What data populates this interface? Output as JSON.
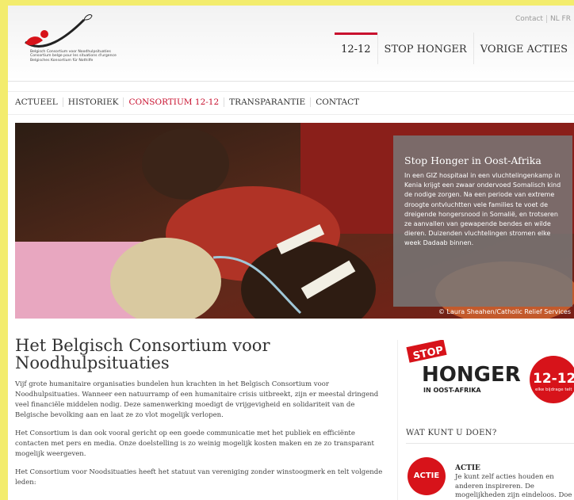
{
  "logo": {
    "lines": [
      "Belgisch Consortium voor Noodhulpsituaties",
      "Consortium belge pour les situations d'urgence",
      "Belgisches Konsortium für Nothilfe"
    ]
  },
  "utility": {
    "contact": "Contact",
    "languages": "NL FR"
  },
  "main_nav": [
    "12-12",
    "STOP HONGER",
    "VORIGE ACTIES"
  ],
  "sub_nav": [
    "ACTUEEL",
    "HISTORIEK",
    "CONSORTIUM 12-12",
    "TRANSPARANTIE",
    "CONTACT"
  ],
  "hero": {
    "title": "Stop Honger in Oost-Afrika",
    "text": "In een GIZ hospitaal in een vluchtelingenkamp in Kenia krijgt een zwaar ondervoed Somalisch kind de nodige zorgen. Na een periode van extreme droogte ontvluchtten vele families te voet de dreigende hongersnood in Somalië, en trotseren ze aanvallen van gewapende bendes en wilde dieren. Duizenden vluchtelingen stromen elke week Dadaab binnen.",
    "credit": "© Laura Sheahen/Catholic Relief Services"
  },
  "content": {
    "title": "Het Belgisch Consortium voor Noodhulpsituaties",
    "p1": "Vijf grote humanitaire organisaties bundelen hun krachten in het Belgisch Consortium voor Noodhulpsituaties. Wanneer een natuurramp of een humanitaire crisis uitbreekt, zijn er meestal dringend veel financiële middelen nodig. Deze samenwerking moedigt de vrijgevigheid en solidariteit van de Belgische bevolking aan en laat ze zo vlot mogelijk verlopen.",
    "p2": "Het Consortium is dan ook vooral gericht op een goede communicatie met het publiek en efficiënte contacten met pers en media. Onze doelstelling is zo weinig mogelijk kosten maken en ze zo transparant mogelijk weergeven.",
    "p3": "Het Consortium voor Noodsituaties heeft het statuut van vereniging zonder winstoogmerk en telt volgende leden:"
  },
  "sidebar": {
    "banner": {
      "stop": "STOP",
      "honger": "HONGER",
      "region": "IN OOST-AFRIKA",
      "number": "12-12",
      "tagline": "elke bijdrage telt"
    },
    "heading": "WAT KUNT U DOEN?",
    "actie": {
      "badge": "ACTIE",
      "title": "ACTIE",
      "text": "Je kunt zelf acties houden en anderen inspireren. De mogelijkheden zijn eindeloos. Doe mee!"
    }
  },
  "colors": {
    "accent": "#c8102e",
    "frame": "#f3ec6d"
  }
}
